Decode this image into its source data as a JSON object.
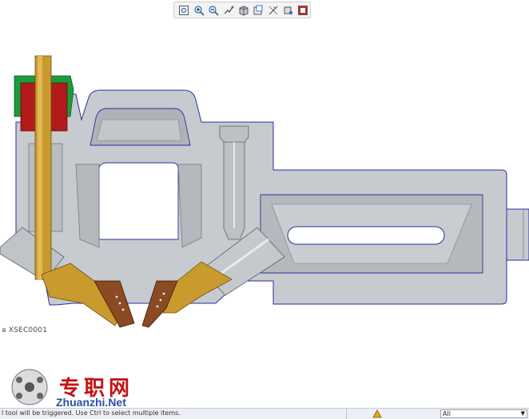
{
  "toolbar": {
    "buttons": [
      {
        "icon": "zoom-fit-icon",
        "tooltip": ""
      },
      {
        "icon": "zoom-in-icon",
        "tooltip": ""
      },
      {
        "icon": "zoom-out-icon",
        "tooltip": ""
      },
      {
        "icon": "repaint-icon",
        "tooltip": ""
      },
      {
        "icon": "shaded-display-icon",
        "tooltip": ""
      },
      {
        "icon": "saved-views-icon",
        "tooltip": ""
      },
      {
        "icon": "datum-display-icon",
        "tooltip": ""
      },
      {
        "icon": "spin-center-icon",
        "tooltip": ""
      },
      {
        "icon": "section-display-icon",
        "tooltip": ""
      }
    ]
  },
  "viewport": {
    "section_label": "a XSEC0001",
    "colors": {
      "body": "#c4c8cc",
      "edge": "#2a2f9c",
      "insert": "#c99a2e",
      "red_part": "#b11b1b",
      "green_part": "#1d9b3a",
      "cutter": "#8a4a22"
    }
  },
  "watermark": {
    "chinese": "专职网",
    "site": "Zhuanzhi.Net"
  },
  "statusbar": {
    "message": "l tool will be triggered. Use Ctrl to select multiple items.",
    "filter_value": "All"
  }
}
